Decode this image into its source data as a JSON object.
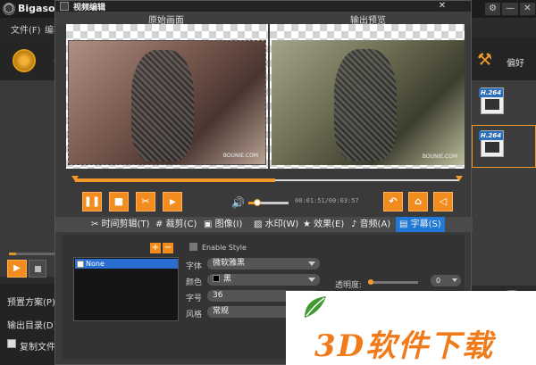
{
  "app": {
    "title": "Bigasoft T",
    "window_buttons": [
      "⚙",
      "—",
      "✕"
    ],
    "menu": [
      "文件(F)",
      "编辑("
    ],
    "toolbar_left_label": "添",
    "toolbar_right_label": "偏好",
    "file_badges": [
      "H.264",
      "H.264"
    ],
    "bottom": {
      "preset_label": "预置方案(P):",
      "output_label": "输出目录(D):",
      "copy_label": "复制文件夹结"
    }
  },
  "dialog": {
    "title": "视频编辑",
    "close": "✕",
    "original_label": "原始画面",
    "output_label": "输出预览",
    "preview_watermark": "BOUNIE.COM",
    "timeline_progress": 0.52,
    "controls": {
      "pause": "❚❚",
      "stop": "■",
      "cut": "✂",
      "split": "⫸",
      "timecode": "00:01:51/00:03:57",
      "volume_level": 0.22,
      "rotate": "↶",
      "clip": "⌂",
      "undo": "◁"
    },
    "tabs": [
      {
        "label": "时间剪辑(T)"
      },
      {
        "label": "裁剪(C)"
      },
      {
        "label": "图像(I)"
      },
      {
        "label": "水印(W)"
      },
      {
        "label": "效果(E)"
      },
      {
        "label": "音频(A)"
      },
      {
        "label": "字幕(S)"
      }
    ],
    "active_tab": "字幕(S)",
    "subtitles": {
      "add": "+",
      "remove": "−",
      "list": [
        "None"
      ],
      "enable_style": "Enable Style",
      "font_label": "字体",
      "font_value": "微软雅黑",
      "color_label": "颜色",
      "color_value": "黑",
      "size_label": "字号",
      "size_value": "36",
      "style_label": "风格",
      "style_value": "常规",
      "opacity_label": "透明度:",
      "opacity_value": "0",
      "opacity_level": 0.0
    }
  },
  "watermark": {
    "text": "3D软件下载"
  },
  "colors": {
    "accent": "#f28c1e",
    "tab_active": "#1e7ad6",
    "watermark_orange": "#f17a1a",
    "watermark_green": "#3f9a2f"
  }
}
